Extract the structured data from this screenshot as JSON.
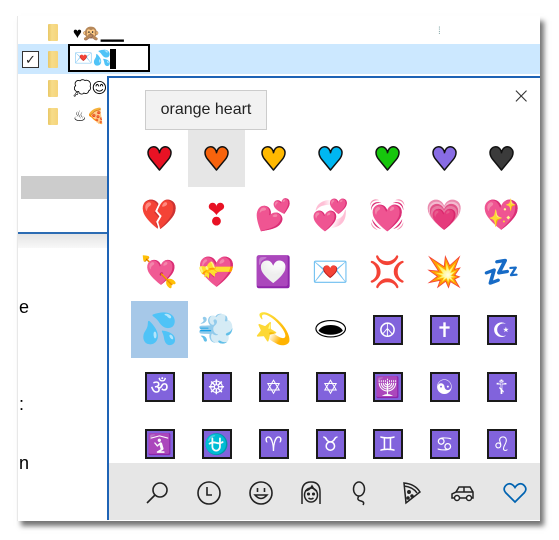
{
  "file_list": {
    "rows": [
      {
        "name": "♥🙊▁▁",
        "checked": false,
        "selected": false
      },
      {
        "name": "💌💦",
        "checked": true,
        "selected": true,
        "editing": true
      },
      {
        "name": "💭😊",
        "checked": false,
        "selected": false
      },
      {
        "name": "♨🍕",
        "checked": false,
        "selected": false
      }
    ],
    "left_panel_chars": [
      "e",
      ":",
      "n"
    ]
  },
  "emoji_picker": {
    "tooltip": "orange heart",
    "close_label": "×",
    "hovered_index": 1,
    "focused_index": 21,
    "emojis": [
      {
        "name": "red heart",
        "char": "♥",
        "color": "#e81224"
      },
      {
        "name": "orange heart",
        "char": "♥",
        "color": "#f7630c"
      },
      {
        "name": "yellow heart",
        "char": "♥",
        "color": "#ffb900"
      },
      {
        "name": "blue heart",
        "char": "♥",
        "color": "#00b7f1"
      },
      {
        "name": "green heart",
        "char": "♥",
        "color": "#16c60c"
      },
      {
        "name": "purple heart",
        "char": "♥",
        "color": "#886ce4"
      },
      {
        "name": "black heart",
        "char": "♥",
        "color": "#3b3b3b"
      },
      {
        "name": "broken heart",
        "char": "💔",
        "color": "#e81224"
      },
      {
        "name": "heavy heart exclamation",
        "char": "❣",
        "color": "#e81224"
      },
      {
        "name": "two hearts",
        "char": "💕",
        "color": "#e81224"
      },
      {
        "name": "revolving hearts",
        "char": "💞",
        "color": "#e81224"
      },
      {
        "name": "beating heart",
        "char": "💓",
        "color": "#e81224"
      },
      {
        "name": "growing heart",
        "char": "💗",
        "color": "#f4abba"
      },
      {
        "name": "sparkling heart",
        "char": "💖",
        "color": "#e81224"
      },
      {
        "name": "heart with arrow",
        "char": "💘",
        "color": "#e81224"
      },
      {
        "name": "heart with ribbon",
        "char": "💝",
        "color": "#e81224"
      },
      {
        "name": "heart decoration",
        "char": "💟",
        "color": "#f4abba"
      },
      {
        "name": "love letter",
        "char": "💌",
        "color": "#e81224"
      },
      {
        "name": "anger symbol",
        "char": "💢",
        "color": "#e81224"
      },
      {
        "name": "collision",
        "char": "💥",
        "color": "#f7630c"
      },
      {
        "name": "zzz",
        "char": "💤",
        "color": "#00b7f1"
      },
      {
        "name": "sweat droplets",
        "char": "💦",
        "color": "#00b7f1"
      },
      {
        "name": "dashing away",
        "char": "💨",
        "color": "#333333"
      },
      {
        "name": "dizzy",
        "char": "💫",
        "color": "#00b7f1"
      },
      {
        "name": "hole",
        "char": "🕳",
        "color": "#000000"
      },
      {
        "name": "peace symbol",
        "char": "☮",
        "boxed": true
      },
      {
        "name": "latin cross",
        "char": "✝",
        "boxed": true
      },
      {
        "name": "star and crescent",
        "char": "☪",
        "boxed": true
      },
      {
        "name": "om",
        "char": "ॐ",
        "boxed": true
      },
      {
        "name": "wheel of dharma",
        "char": "☸",
        "boxed": true
      },
      {
        "name": "star of david",
        "char": "✡",
        "boxed": true
      },
      {
        "name": "dotted six-pointed star",
        "char": "✡",
        "boxed": true
      },
      {
        "name": "menorah",
        "char": "🕎",
        "boxed": true
      },
      {
        "name": "yin yang",
        "char": "☯",
        "boxed": true
      },
      {
        "name": "orthodox cross",
        "char": "☦",
        "boxed": true
      },
      {
        "name": "place of worship",
        "char": "🛐",
        "boxed": true
      },
      {
        "name": "ophiuchus",
        "char": "⛎",
        "boxed": true
      },
      {
        "name": "aries",
        "char": "♈",
        "boxed": true
      },
      {
        "name": "taurus",
        "char": "♉",
        "boxed": true
      },
      {
        "name": "gemini",
        "char": "♊",
        "boxed": true
      },
      {
        "name": "cancer",
        "char": "♋",
        "boxed": true
      },
      {
        "name": "leo",
        "char": "♌",
        "boxed": true
      }
    ],
    "categories": [
      {
        "name": "search",
        "icon": "search-icon"
      },
      {
        "name": "recently used",
        "icon": "clock-icon"
      },
      {
        "name": "smiley faces",
        "icon": "smiley-icon"
      },
      {
        "name": "people",
        "icon": "person-icon"
      },
      {
        "name": "celebrations",
        "icon": "balloon-icon"
      },
      {
        "name": "food",
        "icon": "pizza-icon"
      },
      {
        "name": "transportation",
        "icon": "car-icon"
      },
      {
        "name": "symbols",
        "icon": "heart-icon",
        "active": true
      }
    ],
    "accent_color": "#0063b1"
  }
}
